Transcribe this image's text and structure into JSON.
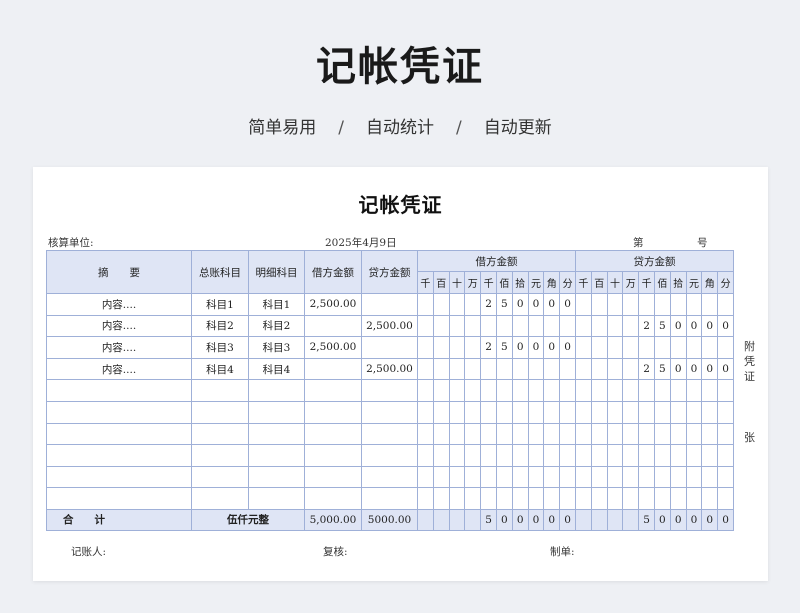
{
  "hero": {
    "title": "记帐凭证",
    "subtitle": [
      "简单易用",
      "自动统计",
      "自动更新"
    ],
    "separator": "/"
  },
  "voucher": {
    "title": "记帐凭证",
    "unit_label": "核算单位:",
    "date": "2025年4月9日",
    "no_label": "第",
    "no_suffix": "号",
    "headers": {
      "summary": "摘　　要",
      "general_account": "总账科目",
      "detail_account": "明细科目",
      "debit_amount": "借方金额",
      "credit_amount": "贷方金额",
      "debit_digits_group": "借方金额",
      "credit_digits_group": "贷方金额",
      "digit_units": [
        "千",
        "百",
        "十",
        "万",
        "千",
        "佰",
        "拾",
        "元",
        "角",
        "分"
      ]
    },
    "rows": [
      {
        "summary": "内容....",
        "general": "科目1",
        "detail": "科目1",
        "debit": "2,500.00",
        "credit": "",
        "debit_digits": [
          "",
          "",
          "",
          "",
          "2",
          "5",
          "0",
          "0",
          "0",
          "0"
        ],
        "credit_digits": [
          "",
          "",
          "",
          "",
          "",
          "",
          "",
          "",
          "",
          ""
        ]
      },
      {
        "summary": "内容....",
        "general": "科目2",
        "detail": "科目2",
        "debit": "",
        "credit": "2,500.00",
        "debit_digits": [
          "",
          "",
          "",
          "",
          "",
          "",
          "",
          "",
          "",
          ""
        ],
        "credit_digits": [
          "",
          "",
          "",
          "",
          "2",
          "5",
          "0",
          "0",
          "0",
          "0"
        ]
      },
      {
        "summary": "内容....",
        "general": "科目3",
        "detail": "科目3",
        "debit": "2,500.00",
        "credit": "",
        "debit_digits": [
          "",
          "",
          "",
          "",
          "2",
          "5",
          "0",
          "0",
          "0",
          "0"
        ],
        "credit_digits": [
          "",
          "",
          "",
          "",
          "",
          "",
          "",
          "",
          "",
          ""
        ]
      },
      {
        "summary": "内容....",
        "general": "科目4",
        "detail": "科目4",
        "debit": "",
        "credit": "2,500.00",
        "debit_digits": [
          "",
          "",
          "",
          "",
          "",
          "",
          "",
          "",
          "",
          ""
        ],
        "credit_digits": [
          "",
          "",
          "",
          "",
          "2",
          "5",
          "0",
          "0",
          "0",
          "0"
        ]
      },
      {
        "summary": "",
        "general": "",
        "detail": "",
        "debit": "",
        "credit": "",
        "debit_digits": [
          "",
          "",
          "",
          "",
          "",
          "",
          "",
          "",
          "",
          ""
        ],
        "credit_digits": [
          "",
          "",
          "",
          "",
          "",
          "",
          "",
          "",
          "",
          ""
        ]
      },
      {
        "summary": "",
        "general": "",
        "detail": "",
        "debit": "",
        "credit": "",
        "debit_digits": [
          "",
          "",
          "",
          "",
          "",
          "",
          "",
          "",
          "",
          ""
        ],
        "credit_digits": [
          "",
          "",
          "",
          "",
          "",
          "",
          "",
          "",
          "",
          ""
        ]
      },
      {
        "summary": "",
        "general": "",
        "detail": "",
        "debit": "",
        "credit": "",
        "debit_digits": [
          "",
          "",
          "",
          "",
          "",
          "",
          "",
          "",
          "",
          ""
        ],
        "credit_digits": [
          "",
          "",
          "",
          "",
          "",
          "",
          "",
          "",
          "",
          ""
        ]
      },
      {
        "summary": "",
        "general": "",
        "detail": "",
        "debit": "",
        "credit": "",
        "debit_digits": [
          "",
          "",
          "",
          "",
          "",
          "",
          "",
          "",
          "",
          ""
        ],
        "credit_digits": [
          "",
          "",
          "",
          "",
          "",
          "",
          "",
          "",
          "",
          ""
        ]
      },
      {
        "summary": "",
        "general": "",
        "detail": "",
        "debit": "",
        "credit": "",
        "debit_digits": [
          "",
          "",
          "",
          "",
          "",
          "",
          "",
          "",
          "",
          ""
        ],
        "credit_digits": [
          "",
          "",
          "",
          "",
          "",
          "",
          "",
          "",
          "",
          ""
        ]
      },
      {
        "summary": "",
        "general": "",
        "detail": "",
        "debit": "",
        "credit": "",
        "debit_digits": [
          "",
          "",
          "",
          "",
          "",
          "",
          "",
          "",
          "",
          ""
        ],
        "credit_digits": [
          "",
          "",
          "",
          "",
          "",
          "",
          "",
          "",
          "",
          ""
        ]
      }
    ],
    "total": {
      "label": "合　　计",
      "amount_words": "伍仟元整",
      "debit": "5,000.00",
      "credit": "5000.00",
      "debit_digits": [
        "",
        "",
        "",
        "",
        "5",
        "0",
        "0",
        "0",
        "0",
        "0"
      ],
      "credit_digits": [
        "",
        "",
        "",
        "",
        "5",
        "0",
        "0",
        "0",
        "0",
        "0"
      ]
    },
    "attachment": {
      "chars": [
        "附",
        "凭",
        "证"
      ],
      "unit": "张"
    },
    "footer": {
      "bookkeeper": "记账人:",
      "reviewer": "复核:",
      "maker": "制单:"
    }
  }
}
